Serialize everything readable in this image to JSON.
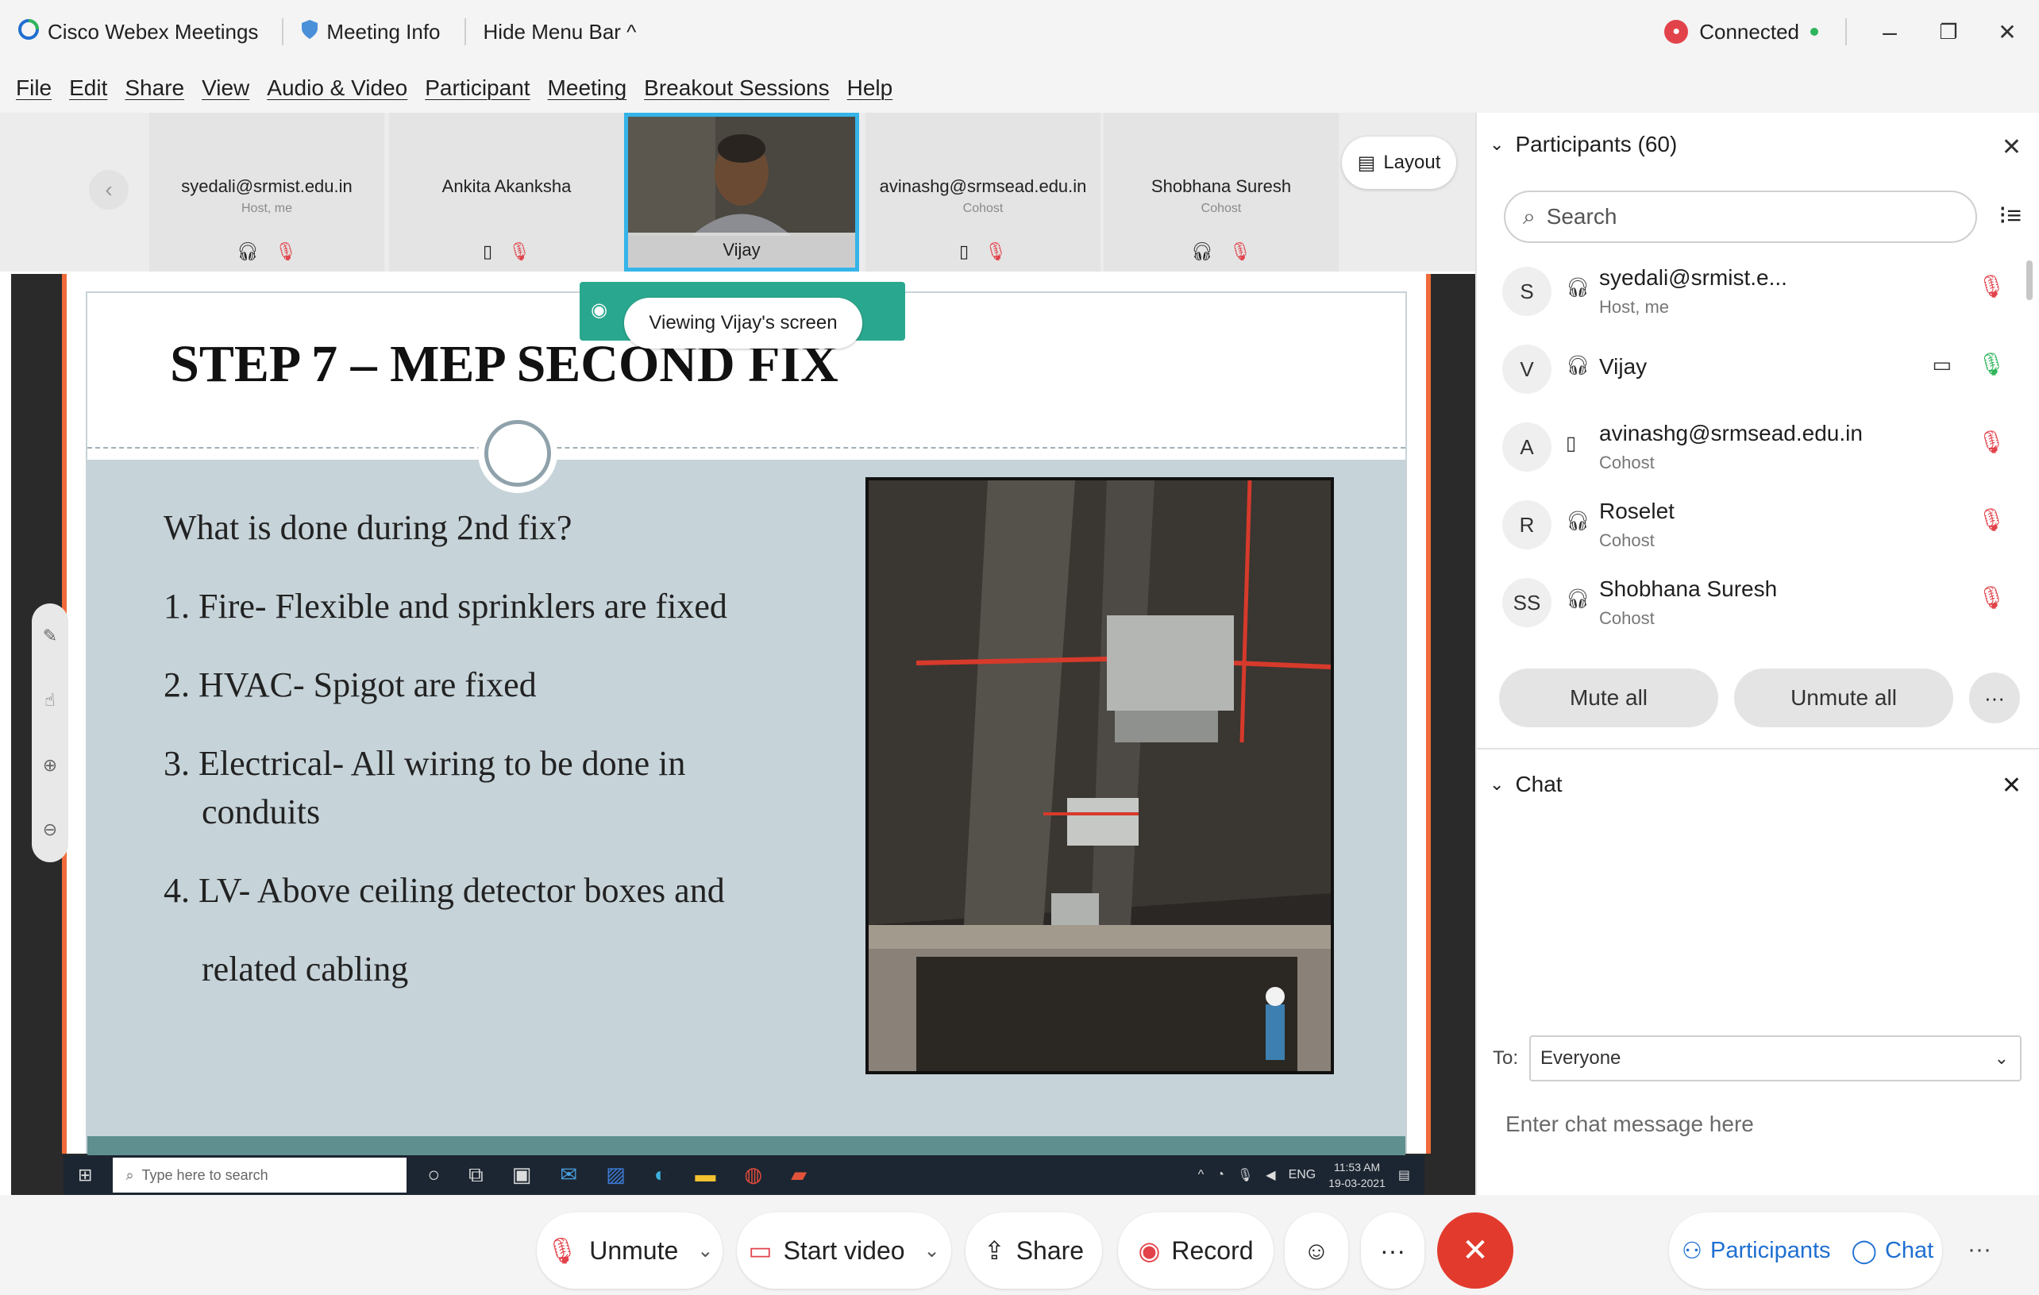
{
  "titlebar": {
    "app_name": "Cisco Webex Meetings",
    "meeting_info": "Meeting Info",
    "hide_menu": "Hide Menu Bar ^",
    "status": "Connected",
    "status_color": "#e2434b"
  },
  "menu": [
    "File",
    "Edit",
    "Share",
    "View",
    "Audio & Video",
    "Participant",
    "Meeting",
    "Breakout Sessions",
    "Help"
  ],
  "thumbnails": [
    {
      "name": "syedali@srmist.edu.in",
      "role": "Host, me"
    },
    {
      "name": "Ankita Akanksha",
      "role": ""
    },
    {
      "name": "Vijay",
      "role": ""
    },
    {
      "name": "avinashg@srmsead.edu.in",
      "role": "Cohost"
    },
    {
      "name": "Shobhana Suresh",
      "role": "Cohost"
    }
  ],
  "layout_label": "Layout",
  "viewing_banner": "Viewing Vijay's screen",
  "slide": {
    "title": "STEP 7 – MEP SECOND FIX",
    "question": "What is done during 2nd fix?",
    "items": [
      "1.  Fire- Flexible and sprinklers are fixed",
      "2.  HVAC- Spigot are fixed",
      "3.  Electrical- All wiring to be done in",
      "conduits",
      "4.  LV- Above ceiling detector boxes and",
      "related  cabling"
    ]
  },
  "taskbar": {
    "search_placeholder": "Type here to search",
    "lang": "ENG",
    "time": "11:53 AM",
    "date": "19-03-2021"
  },
  "participants": {
    "header": "Participants (60)",
    "search_placeholder": "Search",
    "list": [
      {
        "initials": "S",
        "name": "syedali@srmist.e...",
        "role": "Host, me"
      },
      {
        "initials": "V",
        "name": "Vijay",
        "role": ""
      },
      {
        "initials": "A",
        "name": "avinashg@srmsead.edu.in",
        "role": "Cohost"
      },
      {
        "initials": "R",
        "name": "Roselet",
        "role": "Cohost"
      },
      {
        "initials": "SS",
        "name": "Shobhana Suresh",
        "role": "Cohost"
      }
    ],
    "mute_all": "Mute all",
    "unmute_all": "Unmute all"
  },
  "chat": {
    "header": "Chat",
    "to_label": "To:",
    "to_value": "Everyone",
    "placeholder": "Enter chat message here"
  },
  "controls": {
    "unmute": "Unmute",
    "start_video": "Start video",
    "share": "Share",
    "record": "Record",
    "participants": "Participants",
    "chat": "Chat"
  },
  "colors": {
    "accent_blue": "#1f6fd1",
    "end_red": "#e23b2e",
    "banner_green": "#2aa88f",
    "active_border": "#34b4e8"
  }
}
